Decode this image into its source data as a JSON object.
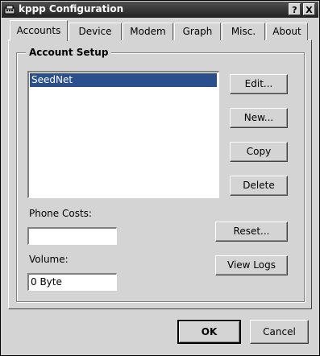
{
  "window": {
    "title": "kppp Configuration",
    "help_button": "?",
    "close_button": "X"
  },
  "tabs": [
    {
      "label": "Accounts",
      "active": true
    },
    {
      "label": "Device",
      "active": false
    },
    {
      "label": "Modem",
      "active": false
    },
    {
      "label": "Graph",
      "active": false
    },
    {
      "label": "Misc.",
      "active": false
    },
    {
      "label": "About",
      "active": false
    }
  ],
  "account_setup": {
    "title": "Account Setup",
    "accounts": [
      "SeedNet"
    ],
    "selected_account": "SeedNet",
    "buttons": {
      "edit": "Edit...",
      "new": "New...",
      "copy": "Copy",
      "delete": "Delete"
    },
    "phone_costs_label": "Phone Costs:",
    "phone_costs_value": "",
    "reset_button": "Reset...",
    "volume_label": "Volume:",
    "volume_value": "0 Byte",
    "view_logs_button": "View Logs"
  },
  "dialog_buttons": {
    "ok": "OK",
    "cancel": "Cancel"
  },
  "colors": {
    "background": "#d4d4d4",
    "selection": "#2a4f8c",
    "titlebar": "#303030"
  }
}
